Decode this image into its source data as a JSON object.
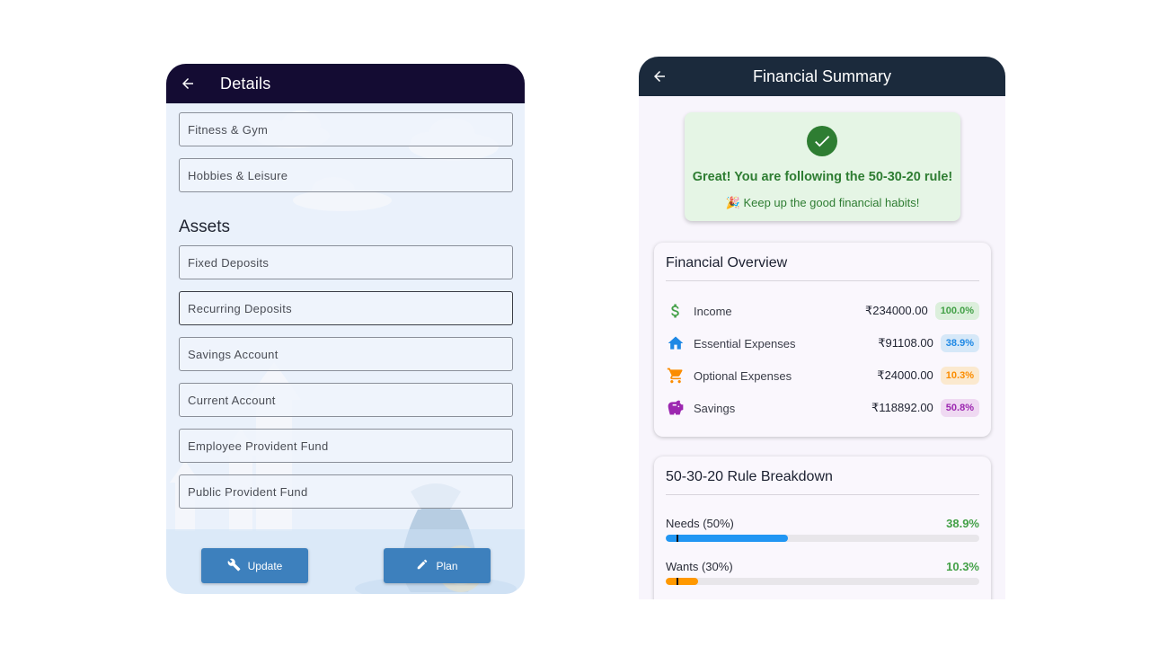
{
  "left": {
    "title": "Details",
    "fields_top": [
      "Fitness & Gym",
      "Hobbies & Leisure"
    ],
    "section_title": "Assets",
    "asset_fields": [
      "Fixed Deposits",
      "Recurring Deposits",
      "Savings Account",
      "Current Account",
      "Employee Provident Fund",
      "Public Provident Fund"
    ],
    "buttons": {
      "update": "Update",
      "plan": "Plan"
    }
  },
  "right": {
    "title": "Financial Summary",
    "success": {
      "title": "Great! You are following the 50-30-20 rule!",
      "subtitle": "🎉 Keep up the good financial habits!"
    },
    "overview": {
      "title": "Financial Overview",
      "rows": [
        {
          "icon": "dollar-icon",
          "label": "Income",
          "amount": "₹234000.00",
          "percent": "100.0%",
          "color": "#43a047",
          "badge_bg": "#dcefdc"
        },
        {
          "icon": "home-icon",
          "label": "Essential Expenses",
          "amount": "₹91108.00",
          "percent": "38.9%",
          "color": "#1e88e5",
          "badge_bg": "#d6e8f8"
        },
        {
          "icon": "cart-icon",
          "label": "Optional Expenses",
          "amount": "₹24000.00",
          "percent": "10.3%",
          "color": "#fb8c00",
          "badge_bg": "#fbe9cf"
        },
        {
          "icon": "piggy-bank-icon",
          "label": "Savings",
          "amount": "₹118892.00",
          "percent": "50.8%",
          "color": "#9c27b0",
          "badge_bg": "#efd9f2"
        }
      ]
    },
    "breakdown": {
      "title": "50-30-20 Rule Breakdown",
      "rows": [
        {
          "label": "Needs (50%)",
          "percent": "38.9%",
          "value": 38.9,
          "target": 50,
          "color": "#2196f3",
          "text_color": "#43a047"
        },
        {
          "label": "Wants (30%)",
          "percent": "10.3%",
          "value": 10.3,
          "target": 30,
          "color": "#ff9800",
          "text_color": "#43a047"
        }
      ]
    }
  }
}
